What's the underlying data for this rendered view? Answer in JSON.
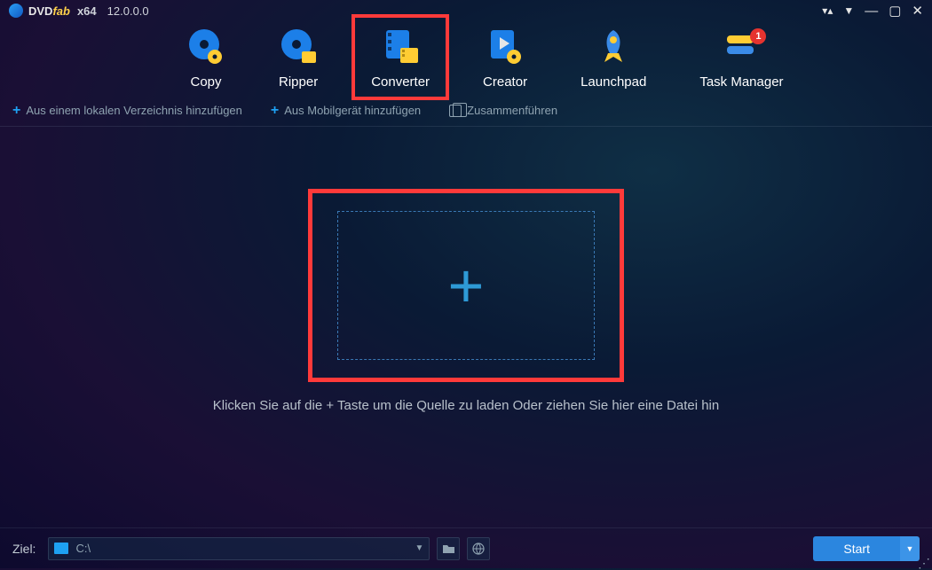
{
  "app": {
    "brand_prefix": "DVD",
    "brand_suffix": "fab",
    "arch": "x64",
    "version": "12.0.0.0"
  },
  "tabs": {
    "copy": "Copy",
    "ripper": "Ripper",
    "converter": "Converter",
    "creator": "Creator",
    "launchpad": "Launchpad",
    "taskmanager": "Task Manager",
    "taskmanager_badge": "1"
  },
  "actions": {
    "add_local": "Aus einem lokalen Verzeichnis hinzufügen",
    "add_mobile": "Aus Mobilgerät hinzufügen",
    "merge": "Zusammenführen"
  },
  "drop": {
    "caption": "Klicken Sie auf die + Taste um die Quelle zu laden Oder ziehen Sie hier eine Datei hin"
  },
  "footer": {
    "dest_label": "Ziel:",
    "dest_value": "C:\\",
    "start_label": "Start"
  }
}
